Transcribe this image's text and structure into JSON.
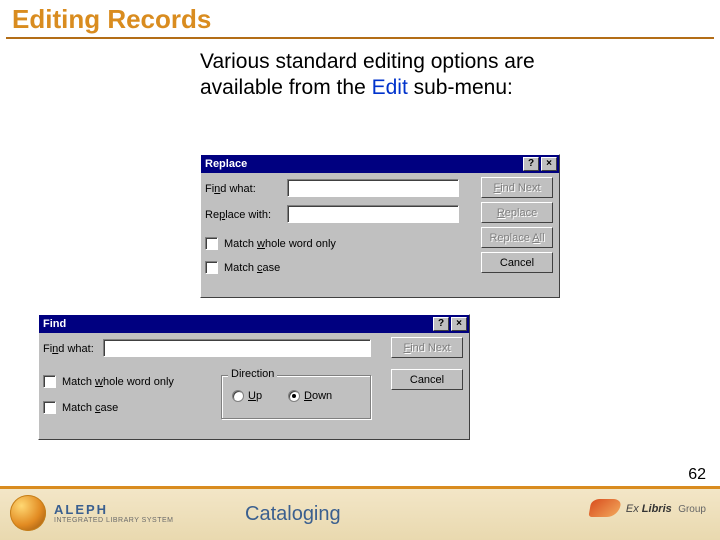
{
  "title": "Editing Records",
  "body": {
    "line1": "Various standard editing options are",
    "line2_a": "available from the ",
    "line2_link": "Edit",
    "line2_b": " sub-menu:"
  },
  "replace_dialog": {
    "title": "Replace",
    "find_label_pre": "Fi",
    "find_label_u": "n",
    "find_label_post": "d what:",
    "replace_label_pre": "Re",
    "replace_label_u": "p",
    "replace_label_post": "lace with:",
    "match_word_pre": "Match ",
    "match_word_u": "w",
    "match_word_post": "hole word only",
    "match_case_pre": "Match ",
    "match_case_u": "c",
    "match_case_post": "ase",
    "find_next_u": "F",
    "find_next_post": "ind Next",
    "replace_btn_u": "R",
    "replace_btn_post": "eplace",
    "replace_all_pre": "Replace ",
    "replace_all_u": "A",
    "replace_all_post": "ll",
    "cancel": "Cancel",
    "help_btn": "?",
    "close_btn": "×"
  },
  "find_dialog": {
    "title": "Find",
    "find_label_pre": "Fi",
    "find_label_u": "n",
    "find_label_post": "d what:",
    "match_word_pre": "Match ",
    "match_word_u": "w",
    "match_word_post": "hole word only",
    "match_case_pre": "Match ",
    "match_case_u": "c",
    "match_case_post": "ase",
    "direction_label": "Direction",
    "up_u": "U",
    "up_post": "p",
    "down_u": "D",
    "down_post": "own",
    "find_next_u": "F",
    "find_next_post": "ind Next",
    "cancel": "Cancel",
    "help_btn": "?",
    "close_btn": "×"
  },
  "page_number": "62",
  "footer": {
    "aleph_top": "ALEPH",
    "aleph_bot": "INTEGRATED LIBRARY SYSTEM",
    "center": "Cataloging",
    "exlibris_a": "Ex",
    "exlibris_b": "Libris",
    "exlibris_c": "Group"
  }
}
